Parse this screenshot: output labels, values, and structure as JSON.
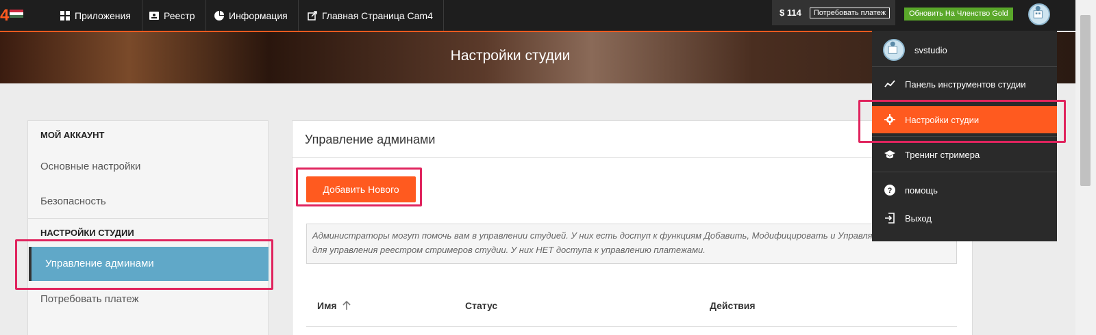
{
  "topbar": {
    "logo_text": "4",
    "nav": [
      {
        "label": "Приложения",
        "icon": "grid-icon"
      },
      {
        "label": "Реестр",
        "icon": "id-card-icon"
      },
      {
        "label": "Информация",
        "icon": "pie-chart-icon"
      },
      {
        "label": "Главная Страница Cam4",
        "icon": "external-link-icon"
      }
    ],
    "balance": "$ 114",
    "claim_label": "Потребовать платеж",
    "gold_label": "Обновить На Членство Gold"
  },
  "hero": {
    "title": "Настройки студии"
  },
  "sidebar": {
    "account_heading": "МОЙ АККАУНТ",
    "items_account": [
      "Основные настройки",
      "Безопасность"
    ],
    "studio_heading": "НАСТРОЙКИ СТУДИИ",
    "active_item": "Управление админами",
    "items_studio": [
      "Потребовать платеж"
    ]
  },
  "main": {
    "title": "Управление админами",
    "add_button": "Добавить Нового",
    "info_text": "Администраторы могут помочь вам в управлении студией. У них есть доступ к функциям Добавить, Модифицировать и Управлять, используемым для управления реестром стримеров студии. У них НЕТ доступа к управлению платежами.",
    "columns": [
      "Имя",
      "Статус",
      "Действия"
    ]
  },
  "dropdown": {
    "username": "svstudio",
    "items": [
      {
        "label": "Панель инструментов студии",
        "icon": "trend-line-icon"
      },
      {
        "label": "Настройки студии",
        "icon": "gear-icon"
      },
      {
        "label": "Тренинг стримера",
        "icon": "graduation-cap-icon"
      },
      {
        "label": "помощь",
        "icon": "question-icon"
      },
      {
        "label": "Выход",
        "icon": "logout-icon"
      }
    ]
  },
  "colors": {
    "accent": "#ff5a1f",
    "sidebar_active": "#60a8c8",
    "gold": "#5aa82a",
    "highlight": "#e0245e"
  }
}
